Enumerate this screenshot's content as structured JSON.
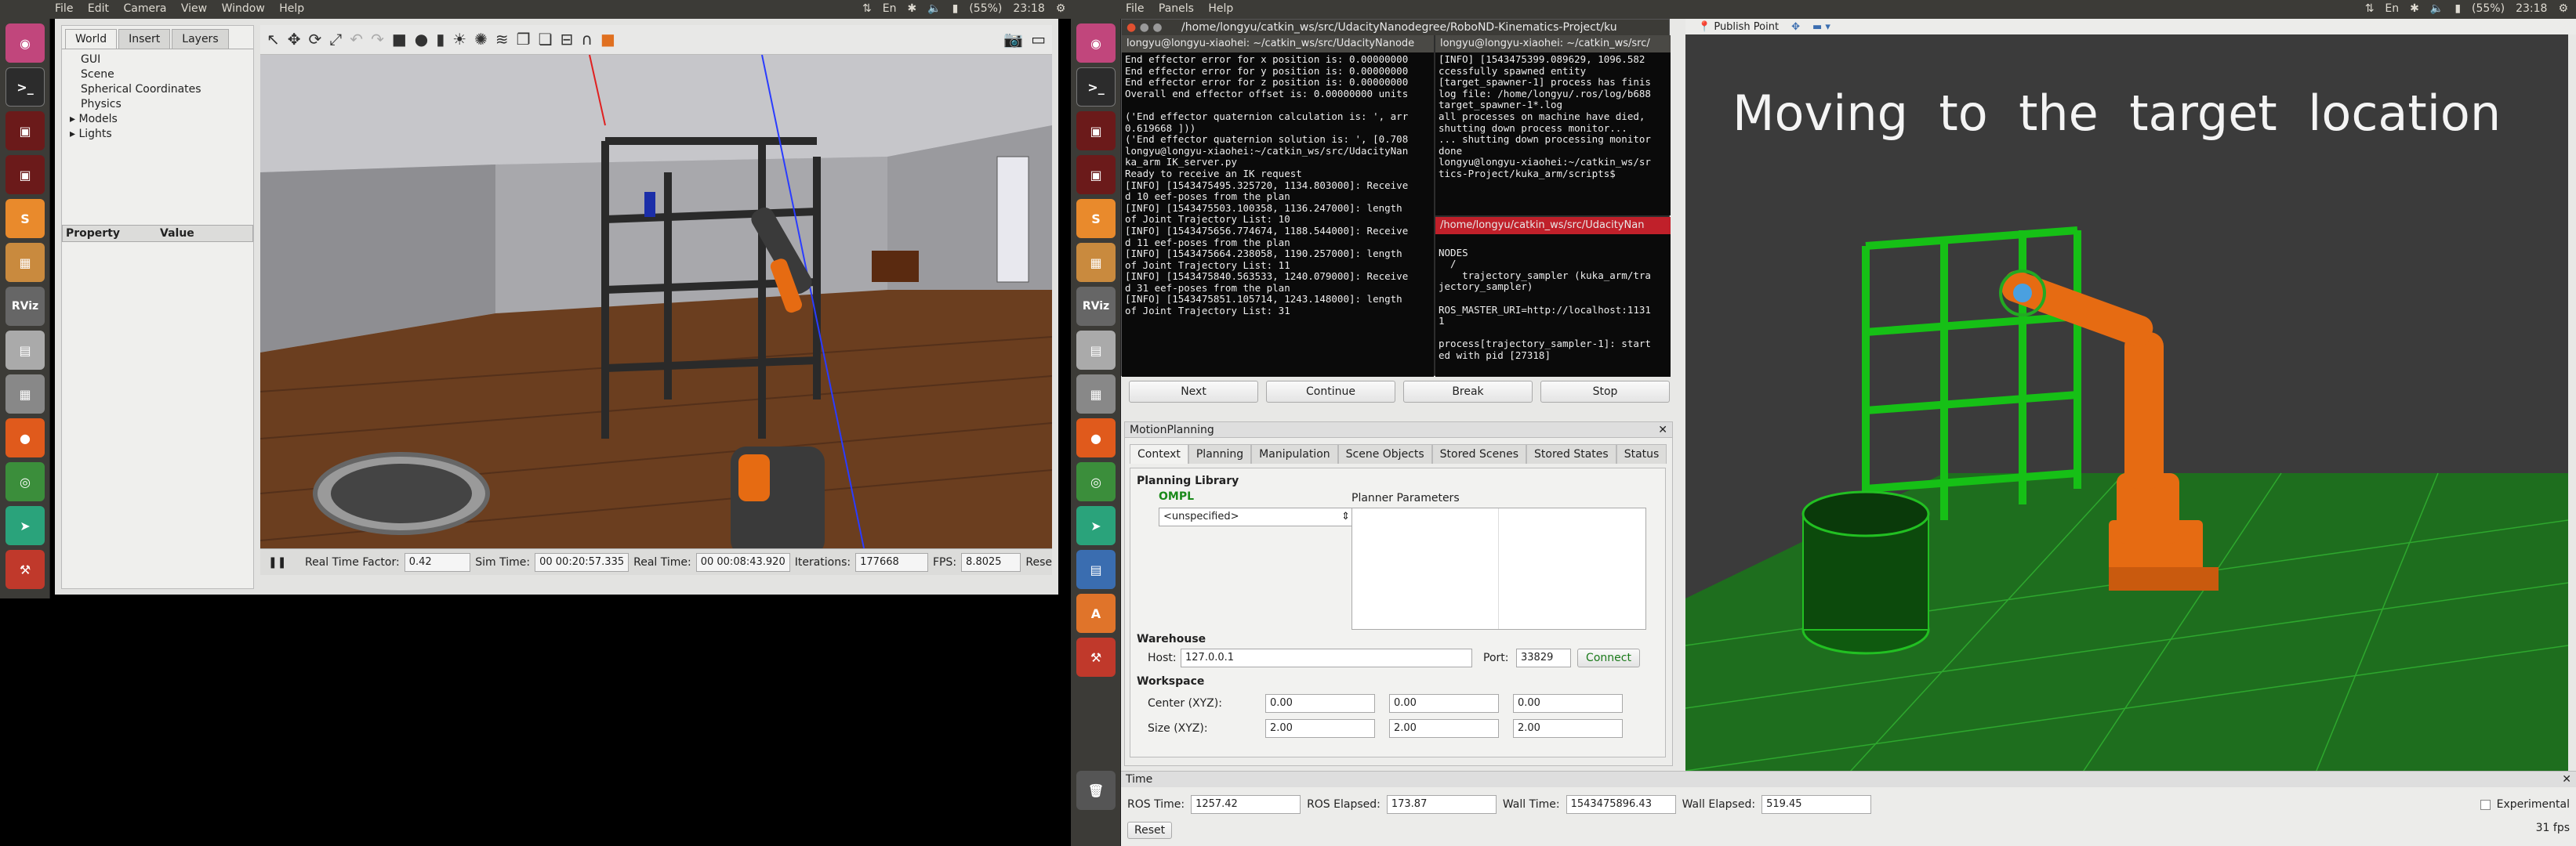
{
  "left_screen": {
    "topbar": {
      "menus": [
        "File",
        "Edit",
        "Camera",
        "View",
        "Window",
        "Help"
      ],
      "battery": "(55%)",
      "time": "23:18"
    },
    "gazebo": {
      "tabs": [
        "World",
        "Insert",
        "Layers"
      ],
      "tree": [
        "GUI",
        "Scene",
        "Spherical Coordinates",
        "Physics",
        "Models",
        "Lights"
      ],
      "prop_headers": [
        "Property",
        "Value"
      ],
      "status": {
        "rtf_label": "Real Time Factor:",
        "rtf": "0.42",
        "sim_label": "Sim Time:",
        "sim": "00 00:20:57.335",
        "real_label": "Real Time:",
        "real": "00 00:08:43.920",
        "iter_label": "Iterations:",
        "iter": "177668",
        "fps_label": "FPS:",
        "fps": "8.8025",
        "reset": "Rese"
      }
    }
  },
  "right_screen": {
    "topbar": {
      "menus": [
        "File",
        "Panels",
        "Help"
      ],
      "battery": "(55%)",
      "time": "23:18"
    },
    "window_title": "/home/longyu/catkin_ws/src/UdacityNanodegree/RoboND-Kinematics-Project/ku",
    "term1_title": "longyu@longyu-xiaohei: ~/catkin_ws/src/UdacityNanode",
    "term2_title": "longyu@longyu-xiaohei: ~/catkin_ws/src/",
    "term3_title": "/home/longyu/catkin_ws/src/UdacityNan",
    "term1_lines": [
      "End effector error for x position is: 0.00000000",
      "End effector error for y position is: 0.00000000",
      "End effector error for z position is: 0.00000000",
      "Overall end effector offset is: 0.00000000 units",
      "",
      "('End effector quaternion calculation is: ', arr",
      "0.619668 ]))",
      "('End effector quaternion solution is: ', [0.708",
      "longyu@longyu-xiaohei:~/catkin_ws/src/UdacityNan",
      "ka_arm IK_server.py",
      "Ready to receive an IK request",
      "[INFO] [1543475495.325720, 1134.803000]: Receive",
      "d 10 eef-poses from the plan",
      "[INFO] [1543475503.100358, 1136.247000]: length",
      "of Joint Trajectory List: 10",
      "[INFO] [1543475656.774674, 1188.544000]: Receive",
      "d 11 eef-poses from the plan",
      "[INFO] [1543475664.238058, 1190.257000]: length",
      "of Joint Trajectory List: 11",
      "[INFO] [1543475840.563533, 1240.079000]: Receive",
      "d 31 eef-poses from the plan",
      "[INFO] [1543475851.105714, 1243.148000]: length",
      "of Joint Trajectory List: 31"
    ],
    "term2_lines": [
      "[INFO] [1543475399.089629, 1096.582",
      "ccessfully spawned entity",
      "[target_spawner-1] process has finis",
      "log file: /home/longyu/.ros/log/b688",
      "target_spawner-1*.log",
      "all processes on machine have died,",
      "shutting down process monitor...",
      "... shutting down processing monitor",
      "done",
      "longyu@longyu-xiaohei:~/catkin_ws/sr",
      "tics-Project/kuka_arm/scripts$"
    ],
    "term3_lines": [
      "",
      "NODES",
      "  /",
      "    trajectory_sampler (kuka_arm/tra",
      "jectory_sampler)",
      "",
      "ROS_MASTER_URI=http://localhost:1131",
      "1",
      "",
      "process[trajectory_sampler-1]: start",
      "ed with pid [27318]"
    ],
    "rviz_toolbar": {
      "publish_point": "Publish Point"
    },
    "control_buttons": [
      "Next",
      "Continue",
      "Break",
      "Stop"
    ],
    "motion_planning": {
      "title": "MotionPlanning",
      "tabs": [
        "Context",
        "Planning",
        "Manipulation",
        "Scene Objects",
        "Stored Scenes",
        "Stored States",
        "Status"
      ],
      "planning_library": "Planning Library",
      "ompl": "OMPL",
      "planner_select": "<unspecified>",
      "planner_params": "Planner Parameters",
      "warehouse": "Warehouse",
      "host_label": "Host:",
      "host": "127.0.0.1",
      "port_label": "Port:",
      "port": "33829",
      "connect": "Connect",
      "workspace": "Workspace",
      "center_label": "Center (XYZ):",
      "center": [
        "0.00",
        "0.00",
        "0.00"
      ],
      "size_label": "Size (XYZ):",
      "size": [
        "2.00",
        "2.00",
        "2.00"
      ]
    },
    "viewport_text": "Moving  to  the  target  location",
    "time_panel": {
      "title": "Time",
      "ros_time_label": "ROS Time:",
      "ros_time": "1257.42",
      "ros_elapsed_label": "ROS Elapsed:",
      "ros_elapsed": "173.87",
      "wall_time_label": "Wall Time:",
      "wall_time": "1543475896.43",
      "wall_elapsed_label": "Wall Elapsed:",
      "wall_elapsed": "519.45",
      "experimental": "Experimental",
      "reset": "Reset",
      "fps": "31 fps"
    }
  },
  "launcher_icons": [
    "ubuntu-dash-icon",
    "terminal-icon",
    "terminal-red-icon",
    "terminal-red-icon",
    "sublime-icon",
    "box-icon",
    "rviz-icon",
    "drawer-icon",
    "calculator-icon",
    "firefox-icon",
    "chrome-icon",
    "send-icon",
    "tools-icon"
  ],
  "colors": {
    "ubuntu_bar": "#3c3b37",
    "terminal_bg": "#300a24",
    "floor_green": "#1f7a1f",
    "robot_orange": "#e66b12",
    "connect_green": "#1a7a1a"
  }
}
